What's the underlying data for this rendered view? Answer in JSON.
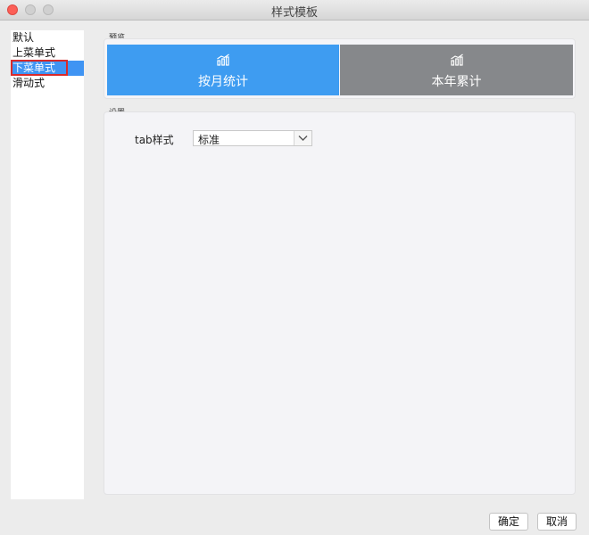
{
  "window": {
    "title": "样式模板"
  },
  "style_list": {
    "items": [
      {
        "label": "默认",
        "selected": false
      },
      {
        "label": "上菜单式",
        "selected": false
      },
      {
        "label": "下菜单式",
        "selected": true
      },
      {
        "label": "滑动式",
        "selected": false
      }
    ]
  },
  "preview": {
    "group_label": "预览",
    "tabs": [
      {
        "label": "按月统计",
        "icon": "bar-chart-icon",
        "color": "#3e9cf1"
      },
      {
        "label": "本年累计",
        "icon": "bar-chart-icon",
        "color": "#86888b"
      }
    ]
  },
  "settings": {
    "group_label": "设置",
    "tab_style_label": "tab样式",
    "tab_style_value": "标准"
  },
  "buttons": {
    "ok": "确定",
    "cancel": "取消"
  },
  "colors": {
    "selection": "#3f94f3",
    "highlight_border": "#d92a2a"
  }
}
